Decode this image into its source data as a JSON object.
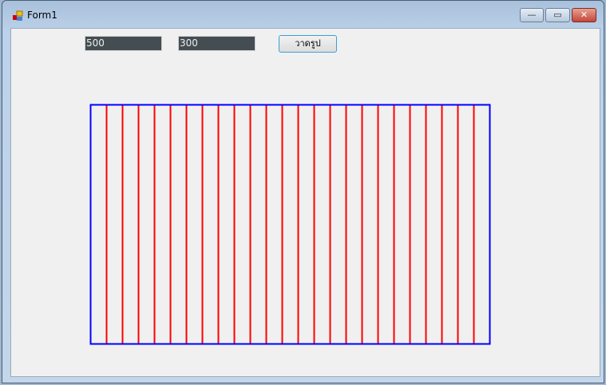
{
  "window": {
    "title": "Form1",
    "minimize_label": "—",
    "maximize_label": "▭",
    "close_label": "✕"
  },
  "inputs": {
    "width_value": "500",
    "height_value": "300"
  },
  "draw_button": {
    "label": "วาดรูป"
  },
  "drawing": {
    "rect_width": 500,
    "rect_height": 300,
    "line_spacing": 20,
    "border_color": "#0000ff",
    "line_color": "#ff0000"
  }
}
